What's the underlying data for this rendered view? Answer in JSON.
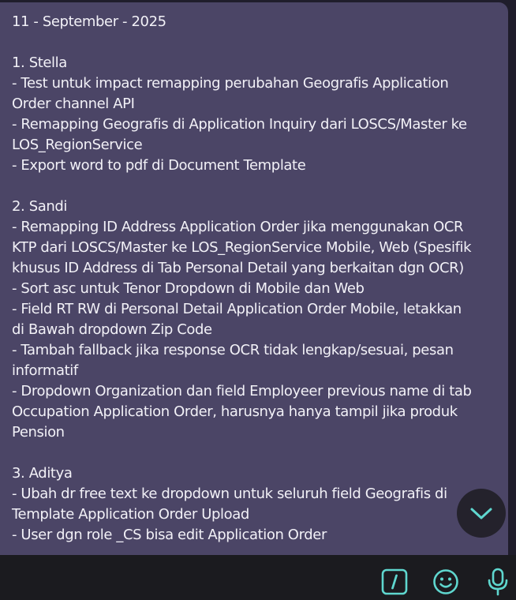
{
  "message": {
    "lines": [
      "11 - September - 2025",
      "",
      "1. Stella",
      "- Test untuk impact remapping perubahan Geografis Application",
      "Order channel API",
      "- Remapping Geografis di Application Inquiry dari LOSCS/Master ke",
      "LOS_RegionService",
      "- Export word to pdf di Document Template",
      "",
      "2. Sandi",
      "- Remapping ID Address Application Order jika menggunakan OCR",
      "KTP dari LOSCS/Master ke LOS_RegionService Mobile, Web (Spesifik",
      "khusus ID Address di Tab Personal Detail yang berkaitan dgn OCR)",
      "- Sort asc untuk Tenor Dropdown di Mobile dan Web",
      "- Field RT RW di Personal Detail Application Order Mobile, letakkan",
      "di Bawah dropdown Zip Code",
      "- Tambah fallback jika response OCR tidak lengkap/sesuai, pesan",
      "informatif",
      "- Dropdown Organization dan field Employeer previous name di tab",
      "Occupation Application Order, harusnya hanya tampil jika produk",
      "Pension",
      "",
      "3. Aditya",
      "- Ubah dr free text ke dropdown untuk seluruh field Geografis di",
      "Template Application Order Upload",
      "- User dgn role _CS bisa edit Application Order"
    ]
  },
  "icons": {
    "scroll_down": "chevron-down-icon",
    "commands": "slash-command-icon",
    "emoji": "smiley-icon",
    "voice": "microphone-icon"
  },
  "colors": {
    "bubble": "#4b4566",
    "text": "#f2f1f7",
    "accent": "#5fd7cf",
    "composer": "#1b1b1f"
  }
}
